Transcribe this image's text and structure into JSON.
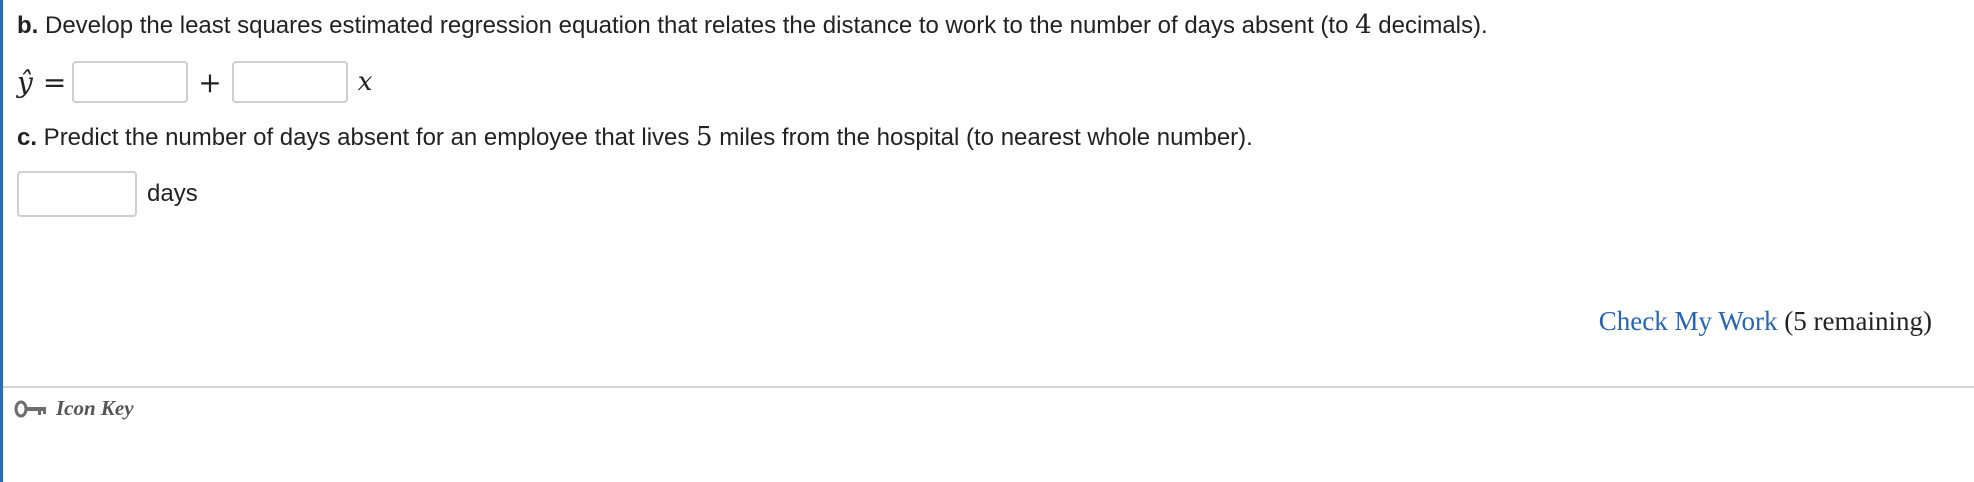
{
  "part_b": {
    "letter": "b.",
    "text_before": " Develop the least squares estimated regression equation that relates the distance to work to the number of days absent (to ",
    "decimals": "4",
    "text_after": " decimals)."
  },
  "equation": {
    "lhs": "ŷ",
    "equals": "=",
    "plus": "+",
    "variable": "x",
    "intercept_value": "",
    "slope_value": ""
  },
  "part_c": {
    "letter": "c.",
    "text_before": " Predict the number of days absent for an employee that lives ",
    "miles": "5",
    "text_after": " miles from the hospital (to nearest whole number).",
    "answer_value": "",
    "unit_label": "days"
  },
  "check": {
    "link_label": "Check My Work",
    "remaining": "(5 remaining)"
  },
  "footer": {
    "icon_key_label": "Icon Key",
    "icon": "key-icon"
  },
  "colors": {
    "link": "#2864b4",
    "left_border": "#2f6bb0",
    "icon_key_text": "#555555"
  }
}
